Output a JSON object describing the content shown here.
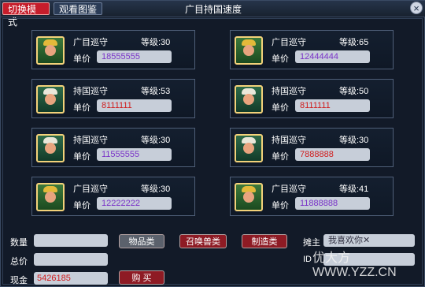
{
  "tabs": {
    "switch_mode": "切换模式",
    "view_gallery": "观看图鉴"
  },
  "title": "广目持国速度",
  "close": "×",
  "cards": [
    {
      "name": "广目巡守",
      "level": "等级:30",
      "price_label": "单价",
      "price": "18555555",
      "price_color": "purple"
    },
    {
      "name": "广目巡守",
      "level": "等级:65",
      "price_label": "单价",
      "price": "12444444",
      "price_color": "purple"
    },
    {
      "name": "持国巡守",
      "level": "等级:53",
      "price_label": "单价",
      "price": "8111111",
      "price_color": "red"
    },
    {
      "name": "持国巡守",
      "level": "等级:50",
      "price_label": "单价",
      "price": "8111111",
      "price_color": "red"
    },
    {
      "name": "持国巡守",
      "level": "等级:30",
      "price_label": "单价",
      "price": "11555555",
      "price_color": "purple"
    },
    {
      "name": "持国巡守",
      "level": "等级:30",
      "price_label": "单价",
      "price": "7888888",
      "price_color": "red"
    },
    {
      "name": "广目巡守",
      "level": "等级:30",
      "price_label": "单价",
      "price": "12222222",
      "price_color": "purple"
    },
    {
      "name": "广目巡守",
      "level": "等级:41",
      "price_label": "单价",
      "price": "11888888",
      "price_color": "purple"
    }
  ],
  "bottom": {
    "qty_label": "数量",
    "total_label": "总价",
    "cash_label": "现金",
    "cash_value": "5426185",
    "btn_items": "物品类",
    "btn_summon": "召唤兽类",
    "btn_craft": "制造类",
    "btn_buy": "购 买",
    "owner_label": "摊主",
    "owner_value": "我喜欢你✕",
    "id_label": "ID"
  },
  "watermark": "优大方 WWW.YZZ.CN"
}
